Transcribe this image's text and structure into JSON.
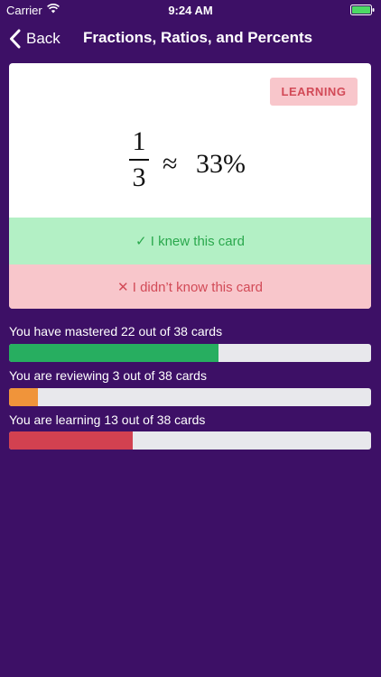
{
  "status_bar": {
    "carrier": "Carrier",
    "time": "9:24 AM"
  },
  "nav": {
    "back_label": "Back",
    "title": "Fractions, Ratios, and Percents"
  },
  "card": {
    "badge": "LEARNING",
    "formula": {
      "numerator": "1",
      "denominator": "3",
      "approx": "≈",
      "percent": "33%"
    },
    "knew_label": "✓ I knew this card",
    "didnt_know_label": "✕ I didn’t know this card"
  },
  "progress": [
    {
      "label": "You have mastered 22 out of 38 cards",
      "value": 22,
      "total": 38,
      "color": "#27ae60"
    },
    {
      "label": "You are reviewing 3 out of 38 cards",
      "value": 3,
      "total": 38,
      "color": "#f0943a"
    },
    {
      "label": "You are learning 13 out of 38 cards",
      "value": 13,
      "total": 38,
      "color": "#d24150"
    }
  ],
  "colors": {
    "background": "#3d1066",
    "badge_bg": "#f8c6cb",
    "badge_text": "#d24a57",
    "knew_bg": "#b3f0c5",
    "knew_text": "#2aa84d"
  }
}
